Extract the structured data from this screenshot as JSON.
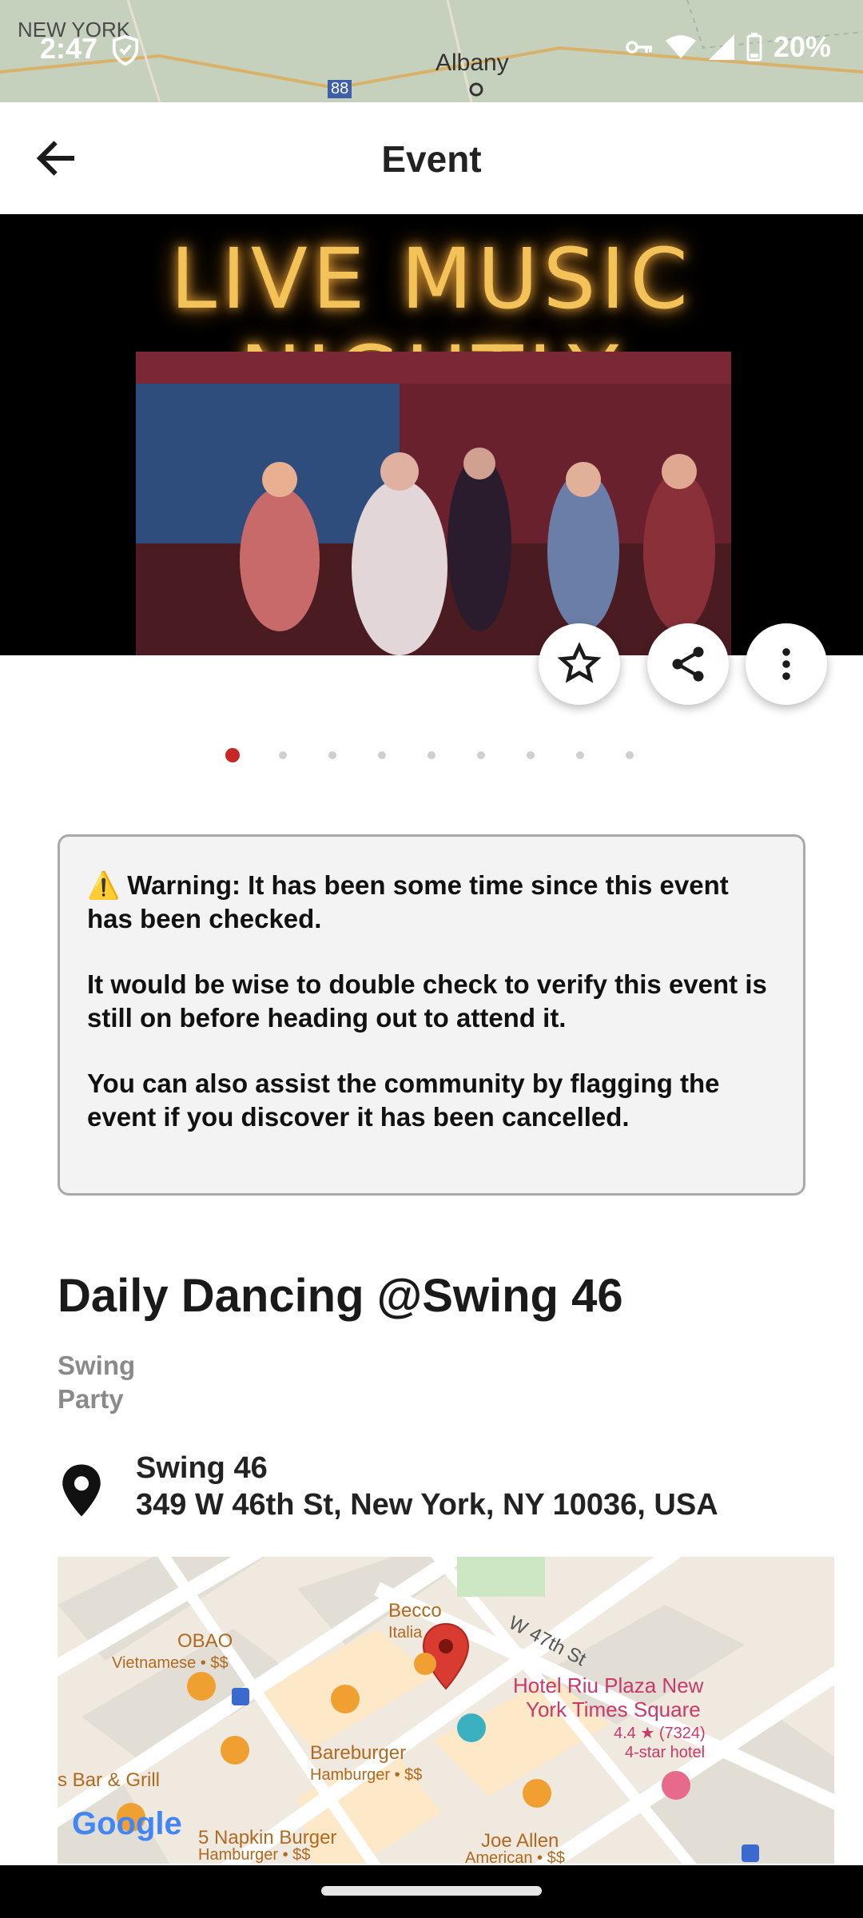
{
  "status_bar": {
    "time": "2:47",
    "battery": "20%",
    "map_labels": [
      "NEW YORK",
      "Albany",
      "88"
    ]
  },
  "app_bar": {
    "title": "Event"
  },
  "hero": {
    "neon_text": "LIVE MUSIC NIGHTLY",
    "carousel_count": 9,
    "carousel_active": 1
  },
  "actions": {
    "favorite_icon": "star-icon",
    "share_icon": "share-icon",
    "more_icon": "more-vert-icon"
  },
  "warning": {
    "line1": "⚠️ Warning: It has been some time since this event has been checked.",
    "line2": "It would be wise to double check to verify this event is still on before heading out to attend it.",
    "line3": "You can also assist the community by flagging the event if you discover it has been cancelled."
  },
  "event": {
    "title": "Daily Dancing @Swing 46",
    "tags": [
      "Swing",
      "Party"
    ],
    "venue_name": "Swing 46",
    "venue_address": "349 W 46th St, New York, NY 10036, USA"
  },
  "map": {
    "street": "W 47th St",
    "poi_obao": "OBAO",
    "poi_obao_sub": "Vietnamese • $$",
    "poi_becco": "Becco",
    "poi_becco_sub": "Italia",
    "poi_hotel": "Hotel Riu Plaza New",
    "poi_hotel2": "York Times Square",
    "poi_hotel_rating": "4.4 ★ (7324)",
    "poi_hotel_sub": "4-star hotel",
    "poi_bareburger": "Bareburger",
    "poi_bareburger_sub": "Hamburger • $$",
    "poi_bar": "s Bar & Grill",
    "poi_napkin": "5 Napkin Burger",
    "poi_napkin_sub": "Hamburger • $$",
    "poi_joe": "Joe Allen",
    "poi_joe_sub": "American • $$",
    "logo": "Google"
  }
}
